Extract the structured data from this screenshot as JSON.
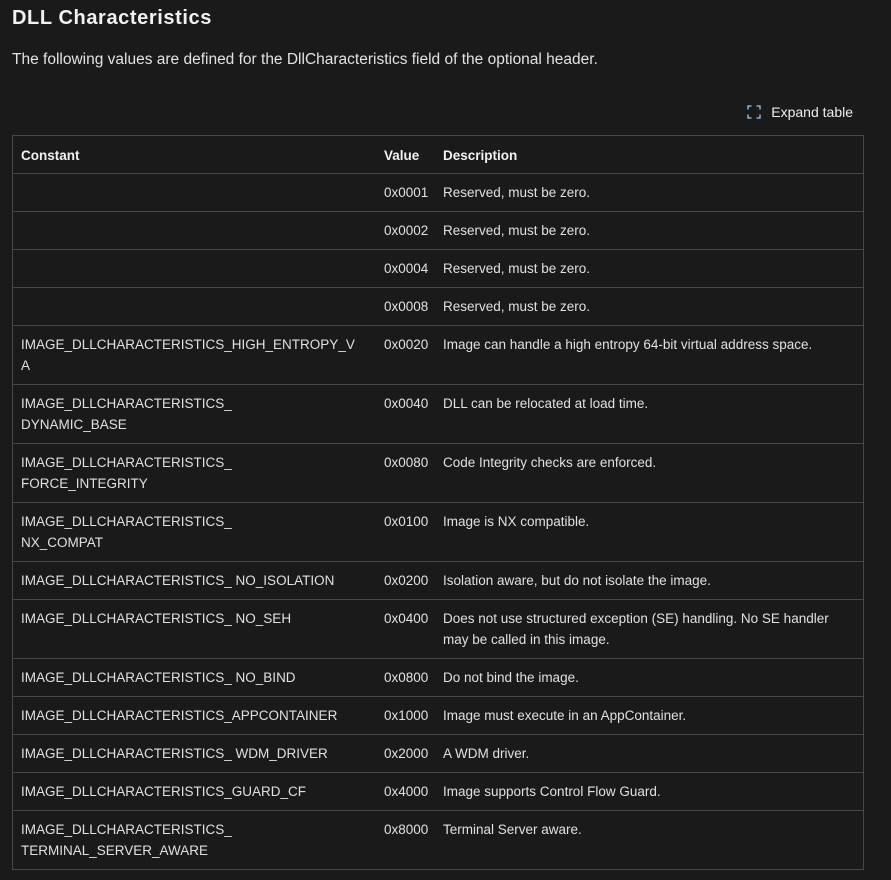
{
  "heading": "DLL Characteristics",
  "intro": "The following values are defined for the DllCharacteristics field of the optional header.",
  "expand_button": {
    "label": "Expand table",
    "icon": "expand-icon"
  },
  "table": {
    "headers": [
      "Constant",
      "Value",
      "Description"
    ],
    "rows": [
      {
        "constant": "",
        "value": "0x0001",
        "description": "Reserved, must be zero."
      },
      {
        "constant": "",
        "value": "0x0002",
        "description": "Reserved, must be zero."
      },
      {
        "constant": "",
        "value": "0x0004",
        "description": "Reserved, must be zero."
      },
      {
        "constant": "",
        "value": "0x0008",
        "description": "Reserved, must be zero."
      },
      {
        "constant": "IMAGE_DLLCHARACTERISTICS_HIGH_ENTROPY_VA",
        "value": "0x0020",
        "description": "Image can handle a high entropy 64-bit virtual address space."
      },
      {
        "constant": "IMAGE_DLLCHARACTERISTICS_\nDYNAMIC_BASE",
        "value": "0x0040",
        "description": "DLL can be relocated at load time."
      },
      {
        "constant": "IMAGE_DLLCHARACTERISTICS_\nFORCE_INTEGRITY",
        "value": "0x0080",
        "description": "Code Integrity checks are enforced."
      },
      {
        "constant": "IMAGE_DLLCHARACTERISTICS_\nNX_COMPAT",
        "value": "0x0100",
        "description": "Image is NX compatible."
      },
      {
        "constant": "IMAGE_DLLCHARACTERISTICS_ NO_ISOLATION",
        "value": "0x0200",
        "description": "Isolation aware, but do not isolate the image."
      },
      {
        "constant": "IMAGE_DLLCHARACTERISTICS_ NO_SEH",
        "value": "0x0400",
        "description": "Does not use structured exception (SE) handling. No SE handler may be called in this image."
      },
      {
        "constant": "IMAGE_DLLCHARACTERISTICS_ NO_BIND",
        "value": "0x0800",
        "description": "Do not bind the image."
      },
      {
        "constant": "IMAGE_DLLCHARACTERISTICS_APPCONTAINER",
        "value": "0x1000",
        "description": "Image must execute in an AppContainer."
      },
      {
        "constant": "IMAGE_DLLCHARACTERISTICS_ WDM_DRIVER",
        "value": "0x2000",
        "description": "A WDM driver."
      },
      {
        "constant": "IMAGE_DLLCHARACTERISTICS_GUARD_CF",
        "value": "0x4000",
        "description": "Image supports Control Flow Guard."
      },
      {
        "constant": "IMAGE_DLLCHARACTERISTICS_\nTERMINAL_SERVER_AWARE",
        "value": "0x8000",
        "description": "Terminal Server aware."
      }
    ]
  }
}
